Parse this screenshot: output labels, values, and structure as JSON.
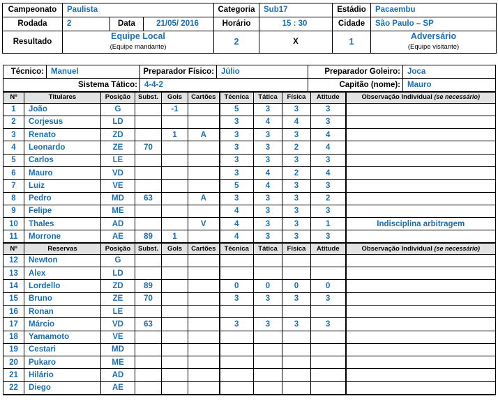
{
  "info": {
    "championship_label": "Campeonato",
    "championship_value": "Paulista",
    "category_label": "Categoria",
    "category_value": "Sub17",
    "stadium_label": "Estádio",
    "stadium_value": "Pacaembu",
    "round_label": "Rodada",
    "round_value": "2",
    "date_label": "Data",
    "date_value": "21/05/ 2016",
    "time_label": "Horário",
    "time_value": "15 : 30",
    "city_label": "Cidade",
    "city_value": "São Paulo – SP",
    "result_label": "Resultado",
    "home_team": "Equipe Local",
    "home_team_sub": "(Equipe mandante)",
    "home_score": "2",
    "x_sep": "X",
    "away_score": "1",
    "away_team": "Adversário",
    "away_team_sub": "(Equipe visitante)"
  },
  "staff": {
    "coach_label": "Técnico:",
    "coach_value": "Manuel",
    "fitness_label": "Preparador Físico:",
    "fitness_value": "Júlio",
    "gk_coach_label": "Preparador Goleiro:",
    "gk_coach_value": "Joca",
    "formation_label": "Sistema Tático:",
    "formation_value": "4-4-2",
    "captain_label": "Capitão (nome):",
    "captain_value": "Mauro"
  },
  "columns": {
    "number": "Nº",
    "starters": "Titulares",
    "reserves": "Reservas",
    "position": "Posição",
    "subst": "Subst.",
    "goals": "Gols",
    "cards": "Cartões",
    "technique": "Técnica",
    "tactics": "Tática",
    "physical": "Física",
    "attitude": "Atitude",
    "observation": "Observação Individual ",
    "observation_italic": "(se necessário)"
  },
  "starters": [
    {
      "num": "1",
      "name": "João",
      "pos": "G",
      "subst": "",
      "goals": "-1",
      "cards": "",
      "tec": "5",
      "tat": "3",
      "fis": "3",
      "ati": "3",
      "obs": ""
    },
    {
      "num": "2",
      "name": "Corjesus",
      "pos": "LD",
      "subst": "",
      "goals": "",
      "cards": "",
      "tec": "3",
      "tat": "4",
      "fis": "4",
      "ati": "3",
      "obs": ""
    },
    {
      "num": "3",
      "name": "Renato",
      "pos": "ZD",
      "subst": "",
      "goals": "1",
      "cards": "A",
      "tec": "3",
      "tat": "3",
      "fis": "3",
      "ati": "4",
      "obs": ""
    },
    {
      "num": "4",
      "name": "Leonardo",
      "pos": "ZE",
      "subst": "70",
      "goals": "",
      "cards": "",
      "tec": "3",
      "tat": "3",
      "fis": "2",
      "ati": "4",
      "obs": ""
    },
    {
      "num": "5",
      "name": "Carlos",
      "pos": "LE",
      "subst": "",
      "goals": "",
      "cards": "",
      "tec": "3",
      "tat": "3",
      "fis": "3",
      "ati": "3",
      "obs": ""
    },
    {
      "num": "6",
      "name": "Mauro",
      "pos": "VD",
      "subst": "",
      "goals": "",
      "cards": "",
      "tec": "3",
      "tat": "4",
      "fis": "2",
      "ati": "4",
      "obs": ""
    },
    {
      "num": "7",
      "name": "Luiz",
      "pos": "VE",
      "subst": "",
      "goals": "",
      "cards": "",
      "tec": "5",
      "tat": "4",
      "fis": "3",
      "ati": "3",
      "obs": ""
    },
    {
      "num": "8",
      "name": "Pedro",
      "pos": "MD",
      "subst": "63",
      "goals": "",
      "cards": "A",
      "tec": "3",
      "tat": "3",
      "fis": "3",
      "ati": "2",
      "obs": ""
    },
    {
      "num": "9",
      "name": "Felipe",
      "pos": "ME",
      "subst": "",
      "goals": "",
      "cards": "",
      "tec": "4",
      "tat": "3",
      "fis": "3",
      "ati": "3",
      "obs": ""
    },
    {
      "num": "10",
      "name": "Thales",
      "pos": "AD",
      "subst": "",
      "goals": "",
      "cards": "V",
      "tec": "4",
      "tat": "3",
      "fis": "3",
      "ati": "1",
      "obs": "Indisciplina arbitragem"
    },
    {
      "num": "11",
      "name": "Morrone",
      "pos": "AE",
      "subst": "89",
      "goals": "1",
      "cards": "",
      "tec": "4",
      "tat": "3",
      "fis": "3",
      "ati": "3",
      "obs": ""
    }
  ],
  "reserves": [
    {
      "num": "12",
      "name": "Newton",
      "pos": "G",
      "subst": "",
      "goals": "",
      "cards": "",
      "tec": "",
      "tat": "",
      "fis": "",
      "ati": "",
      "obs": ""
    },
    {
      "num": "13",
      "name": "Alex",
      "pos": "LD",
      "subst": "",
      "goals": "",
      "cards": "",
      "tec": "",
      "tat": "",
      "fis": "",
      "ati": "",
      "obs": ""
    },
    {
      "num": "14",
      "name": "Lordello",
      "pos": "ZD",
      "subst": "89",
      "goals": "",
      "cards": "",
      "tec": "0",
      "tat": "0",
      "fis": "0",
      "ati": "0",
      "obs": ""
    },
    {
      "num": "15",
      "name": "Bruno",
      "pos": "ZE",
      "subst": "70",
      "goals": "",
      "cards": "",
      "tec": "3",
      "tat": "3",
      "fis": "3",
      "ati": "3",
      "obs": ""
    },
    {
      "num": "16",
      "name": "Ronan",
      "pos": "LE",
      "subst": "",
      "goals": "",
      "cards": "",
      "tec": "",
      "tat": "",
      "fis": "",
      "ati": "",
      "obs": ""
    },
    {
      "num": "17",
      "name": "Márcio",
      "pos": "VD",
      "subst": "63",
      "goals": "",
      "cards": "",
      "tec": "3",
      "tat": "3",
      "fis": "3",
      "ati": "3",
      "obs": ""
    },
    {
      "num": "18",
      "name": "Yamamoto",
      "pos": "VE",
      "subst": "",
      "goals": "",
      "cards": "",
      "tec": "",
      "tat": "",
      "fis": "",
      "ati": "",
      "obs": ""
    },
    {
      "num": "19",
      "name": "Cestari",
      "pos": "MD",
      "subst": "",
      "goals": "",
      "cards": "",
      "tec": "",
      "tat": "",
      "fis": "",
      "ati": "",
      "obs": ""
    },
    {
      "num": "20",
      "name": "Pukaro",
      "pos": "ME",
      "subst": "",
      "goals": "",
      "cards": "",
      "tec": "",
      "tat": "",
      "fis": "",
      "ati": "",
      "obs": ""
    },
    {
      "num": "21",
      "name": "Hilário",
      "pos": "AD",
      "subst": "",
      "goals": "",
      "cards": "",
      "tec": "",
      "tat": "",
      "fis": "",
      "ati": "",
      "obs": ""
    },
    {
      "num": "22",
      "name": "Diego",
      "pos": "AE",
      "subst": "",
      "goals": "",
      "cards": "",
      "tec": "",
      "tat": "",
      "fis": "",
      "ati": "",
      "obs": ""
    }
  ],
  "colors": {
    "value_blue": "#1a6fb4",
    "header_gray": "#e2e2e2",
    "border": "#000000"
  }
}
